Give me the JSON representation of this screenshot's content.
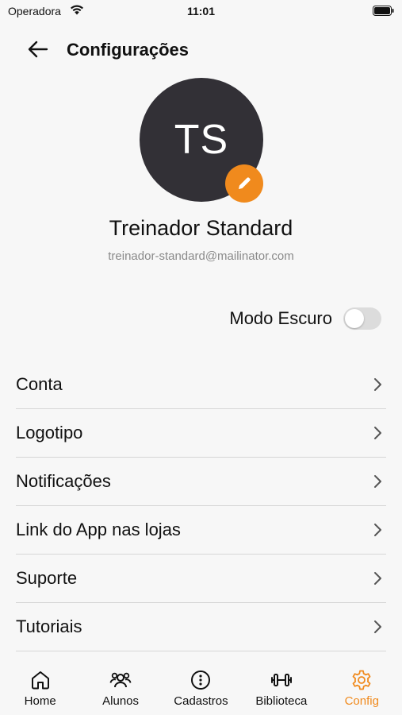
{
  "status_bar": {
    "carrier": "Operadora",
    "time": "11:01"
  },
  "header": {
    "title": "Configurações",
    "back_icon": "arrow-left-icon"
  },
  "profile": {
    "initials": "TS",
    "name": "Treinador Standard",
    "email": "treinador-standard@mailinator.com",
    "edit_icon": "pencil-icon"
  },
  "dark_mode": {
    "label": "Modo Escuro",
    "enabled": false
  },
  "menu": [
    {
      "label": "Conta"
    },
    {
      "label": "Logotipo"
    },
    {
      "label": "Notificações"
    },
    {
      "label": "Link do App nas lojas"
    },
    {
      "label": "Suporte"
    },
    {
      "label": "Tutoriais"
    }
  ],
  "bottom_nav": [
    {
      "label": "Home",
      "icon": "home-icon",
      "active": false
    },
    {
      "label": "Alunos",
      "icon": "users-icon",
      "active": false
    },
    {
      "label": "Cadastros",
      "icon": "more-circle-icon",
      "active": false
    },
    {
      "label": "Biblioteca",
      "icon": "dumbbell-icon",
      "active": false
    },
    {
      "label": "Config",
      "icon": "gear-icon",
      "active": true
    }
  ],
  "colors": {
    "accent": "#f08a1d",
    "avatar_bg": "#323036",
    "background": "#f7f7f7"
  }
}
